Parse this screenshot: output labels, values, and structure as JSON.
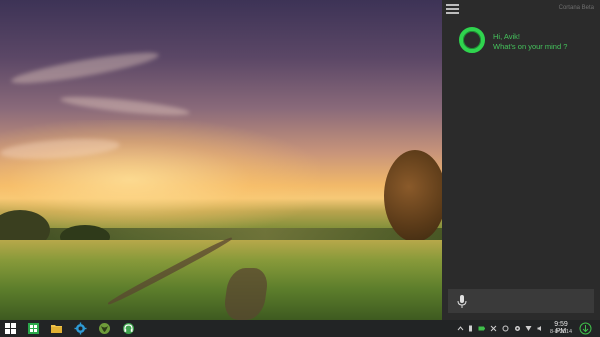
{
  "cortana": {
    "title": "Cortana Beta",
    "greeting_line1": "Hi, Avik!",
    "greeting_line2": "What's on your mind ?"
  },
  "taskbar": {
    "clock": {
      "time": "9:59 PM",
      "date": "8-8-2014"
    },
    "colors": {
      "accent": "#2fd44e",
      "panel_bg": "#2b2b2b",
      "taskbar_bg": "#222425"
    }
  },
  "icons": {
    "start": "windows-logo-icon",
    "store": "store-icon",
    "explorer": "folder-icon",
    "settings": "gear-icon",
    "app1": "xbox-icon",
    "app2": "headphones-icon",
    "mic": "microphone-icon"
  }
}
